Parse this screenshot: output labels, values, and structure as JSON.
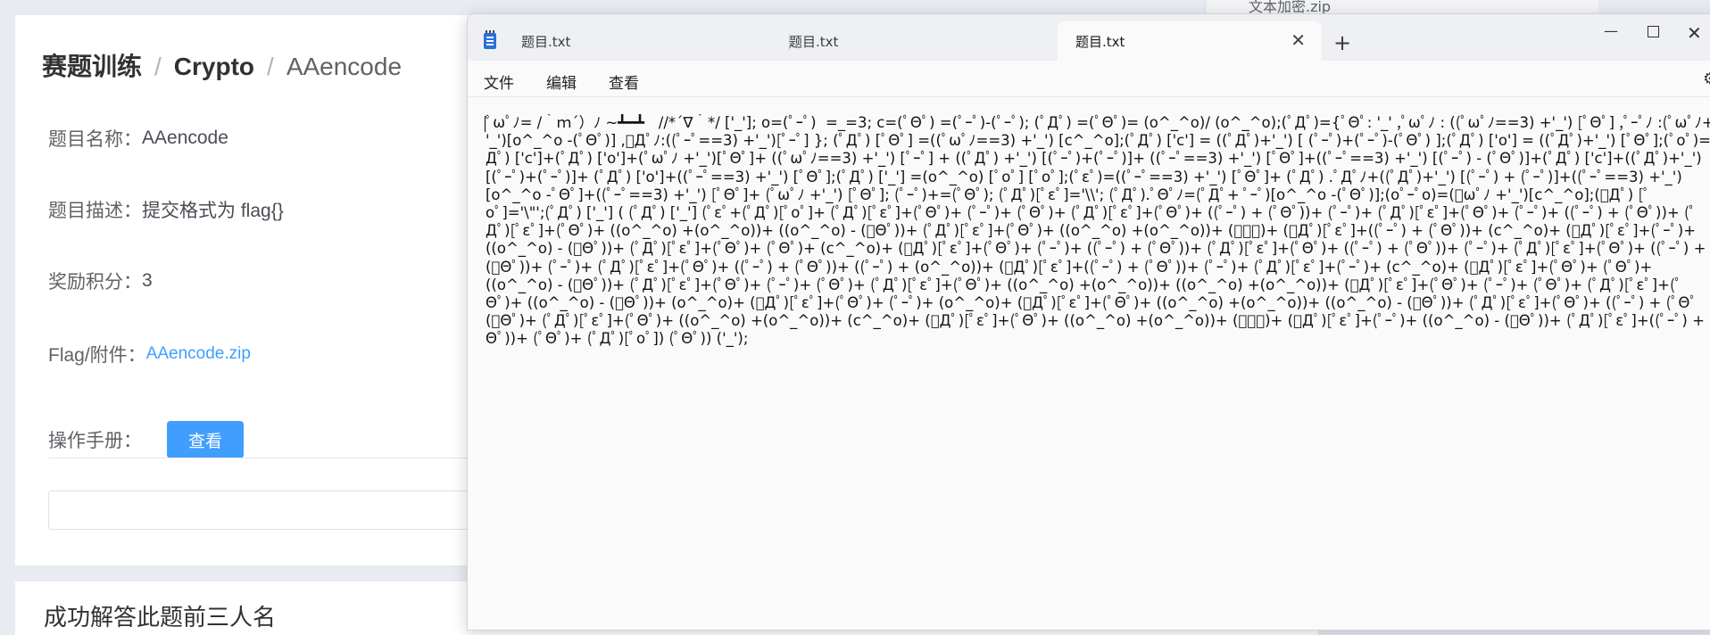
{
  "web": {
    "breadcrumb": {
      "item1": "赛题训练",
      "sep1": "/",
      "item2": "Crypto",
      "sep2": "/",
      "item3": "AAencode"
    },
    "name_label": "题目名称：",
    "name_value": "AAencode",
    "desc_label": "题目描述：",
    "desc_value": "提交格式为 flag{}",
    "points_label": "奖励积分：",
    "points_value": "3",
    "attach_label": "Flag/附件：",
    "attach_link": "AAencode.zip",
    "manual_label": "操作手册：",
    "view_button": "查看",
    "solvers_title": "成功解答此题前三人名",
    "right_panel_text": "文本加密.zip"
  },
  "notepad": {
    "tabs": [
      {
        "label": "题目.txt"
      },
      {
        "label": "题目.txt"
      },
      {
        "label": "题目.txt",
        "active": true
      }
    ],
    "close_glyph": "✕",
    "add_glyph": "+",
    "minimize_glyph": "—",
    "close_window_glyph": "✕",
    "menu": {
      "file": "文件",
      "edit": "编辑",
      "view": "查看"
    },
    "settings_glyph": "⚙",
    "content": "ﾟωﾟﾉ= /｀ｍ´）ﾉ ~┻━┻   //*´∇｀*/ ['_']; o=(ﾟｰﾟ)  =_=3; c=(ﾟΘﾟ) =(ﾟｰﾟ)-(ﾟｰﾟ); (ﾟДﾟ) =(ﾟΘﾟ)= (o^_^o)/ (o^_^o);(ﾟДﾟ)={ﾟΘﾟ: '_' ,ﾟωﾟﾉ : ((ﾟωﾟﾉ==3) +'_') [ﾟΘﾟ] ,ﾟｰﾟﾉ :(ﾟωﾟﾉ+\n'_')[o^_^o -(ﾟΘﾟ)] ,ﾟДﾟﾉ:((ﾟｰﾟ==3) +'_')[ﾟｰﾟ] }; (ﾟДﾟ) [ﾟΘﾟ] =((ﾟωﾟﾉ==3) +'_') [c^_^o];(ﾟДﾟ) ['c'] = ((ﾟДﾟ)+'_') [ (ﾟｰﾟ)+(ﾟｰﾟ)-(ﾟΘﾟ) ];(ﾟДﾟ) ['o'] = ((ﾟДﾟ)+'_') [ﾟΘﾟ];(ﾟoﾟ)=(ﾟ\nДﾟ) ['c']+(ﾟДﾟ) ['o']+(ﾟωﾟﾉ +'_')[ﾟΘﾟ]+ ((ﾟωﾟﾉ==3) +'_') [ﾟｰﾟ] + ((ﾟДﾟ) +'_') [(ﾟｰﾟ)+(ﾟｰﾟ)]+ ((ﾟｰﾟ==3) +'_') [ﾟΘﾟ]+((ﾟｰﾟ==3) +'_') [(ﾟｰﾟ) - (ﾟΘﾟ)]+(ﾟДﾟ) ['c']+((ﾟДﾟ)+'_')\n[(ﾟｰﾟ)+(ﾟｰﾟ)]+ (ﾟДﾟ) ['o']+((ﾟｰﾟ==3) +'_') [ﾟΘﾟ];(ﾟДﾟ) ['_'] =(o^_^o) [ﾟoﾟ] [ﾟoﾟ];(ﾟεﾟ)=((ﾟｰﾟ==3) +'_') [ﾟΘﾟ]+ (ﾟДﾟ) .ﾟДﾟﾉ+((ﾟДﾟ)+'_') [(ﾟｰﾟ) + (ﾟｰﾟ)]+((ﾟｰﾟ==3) +'_')\n[o^_^o -ﾟΘﾟ]+((ﾟｰﾟ==3) +'_') [ﾟΘﾟ]+ (ﾟωﾟﾉ +'_') [ﾟΘﾟ]; (ﾟｰﾟ)+=(ﾟΘﾟ); (ﾟДﾟ)[ﾟεﾟ]='\\\\'; (ﾟДﾟ).ﾟΘﾟﾉ=(ﾟДﾟ+ ﾟｰﾟ)[o^_^o -(ﾟΘﾟ)];(oﾟｰﾟo)=(ﾟωﾟﾉ +'_')[c^_^o];(ﾟДﾟ) [ﾟ\noﾟ]='\\\"';(ﾟДﾟ) ['_'] ( (ﾟДﾟ) ['_'] (ﾟεﾟ+(ﾟДﾟ)[ﾟoﾟ]+ (ﾟДﾟ)[ﾟεﾟ]+(ﾟΘﾟ)+ (ﾟｰﾟ)+ (ﾟΘﾟ)+ (ﾟДﾟ)[ﾟεﾟ]+(ﾟΘﾟ)+ ((ﾟｰﾟ) + (ﾟΘﾟ))+ (ﾟｰﾟ)+ (ﾟДﾟ)[ﾟεﾟ]+(ﾟΘﾟ)+ (ﾟｰﾟ)+ ((ﾟｰﾟ) + (ﾟΘﾟ))+ (ﾟ\nДﾟ)[ﾟεﾟ]+(ﾟΘﾟ)+ ((o^_^o) +(o^_^o))+ ((o^_^o) - (ﾟΘﾟ))+ (ﾟДﾟ)[ﾟεﾟ]+(ﾟΘﾟ)+ ((o^_^o) +(o^_^o))+ (ﾟｰﾟ)+ (ﾟДﾟ)[ﾟεﾟ]+((ﾟｰﾟ) + (ﾟΘﾟ))+ (c^_^o)+ (ﾟДﾟ)[ﾟεﾟ]+(ﾟｰﾟ)+\n((o^_^o) - (ﾟΘﾟ))+ (ﾟДﾟ)[ﾟεﾟ]+(ﾟΘﾟ)+ (ﾟΘﾟ)+ (c^_^o)+ (ﾟДﾟ)[ﾟεﾟ]+(ﾟΘﾟ)+ (ﾟｰﾟ)+ ((ﾟｰﾟ) + (ﾟΘﾟ))+ (ﾟДﾟ)[ﾟεﾟ]+(ﾟΘﾟ)+ ((ﾟｰﾟ) + (ﾟΘﾟ))+ (ﾟｰﾟ)+ (ﾟДﾟ)[ﾟεﾟ]+(ﾟΘﾟ)+ ((ﾟｰﾟ) +\n(ﾟΘﾟ))+ (ﾟｰﾟ)+ (ﾟДﾟ)[ﾟεﾟ]+(ﾟΘﾟ)+ ((ﾟｰﾟ) + (ﾟΘﾟ))+ ((ﾟｰﾟ) + (o^_^o))+ (ﾟДﾟ)[ﾟεﾟ]+((ﾟｰﾟ) + (ﾟΘﾟ))+ (ﾟｰﾟ)+ (ﾟДﾟ)[ﾟεﾟ]+(ﾟｰﾟ)+ (c^_^o)+ (ﾟДﾟ)[ﾟεﾟ]+(ﾟΘﾟ)+ (ﾟΘﾟ)+\n((o^_^o) - (ﾟΘﾟ))+ (ﾟДﾟ)[ﾟεﾟ]+(ﾟΘﾟ)+ (ﾟｰﾟ)+ (ﾟΘﾟ)+ (ﾟДﾟ)[ﾟεﾟ]+(ﾟΘﾟ)+ ((o^_^o) +(o^_^o))+ ((o^_^o) +(o^_^o))+ (ﾟДﾟ)[ﾟεﾟ]+(ﾟΘﾟ)+ (ﾟｰﾟ)+ (ﾟΘﾟ)+ (ﾟДﾟ)[ﾟεﾟ]+(ﾟ\nΘﾟ)+ ((o^_^o) - (ﾟΘﾟ))+ (o^_^o)+ (ﾟДﾟ)[ﾟεﾟ]+(ﾟΘﾟ)+ (ﾟｰﾟ)+ (o^_^o)+ (ﾟДﾟ)[ﾟεﾟ]+(ﾟΘﾟ)+ ((o^_^o) +(o^_^o))+ ((o^_^o) - (ﾟΘﾟ))+ (ﾟДﾟ)[ﾟεﾟ]+(ﾟΘﾟ)+ ((ﾟｰﾟ) + (ﾟΘﾟ\n(ﾟΘﾟ)+ (ﾟДﾟ)[ﾟεﾟ]+(ﾟΘﾟ)+ ((o^_^o) +(o^_^o))+ (c^_^o)+ (ﾟДﾟ)[ﾟεﾟ]+(ﾟΘﾟ)+ ((o^_^o) +(o^_^o))+ (ﾟｰﾟ)+ (ﾟДﾟ)[ﾟεﾟ]+(ﾟｰﾟ)+ ((o^_^o) - (ﾟΘﾟ))+ (ﾟДﾟ)[ﾟεﾟ]+((ﾟｰﾟ) +\nΘﾟ))+ (ﾟΘﾟ)+ (ﾟДﾟ)[ﾟoﾟ]) (ﾟΘﾟ)) ('_');"
  }
}
